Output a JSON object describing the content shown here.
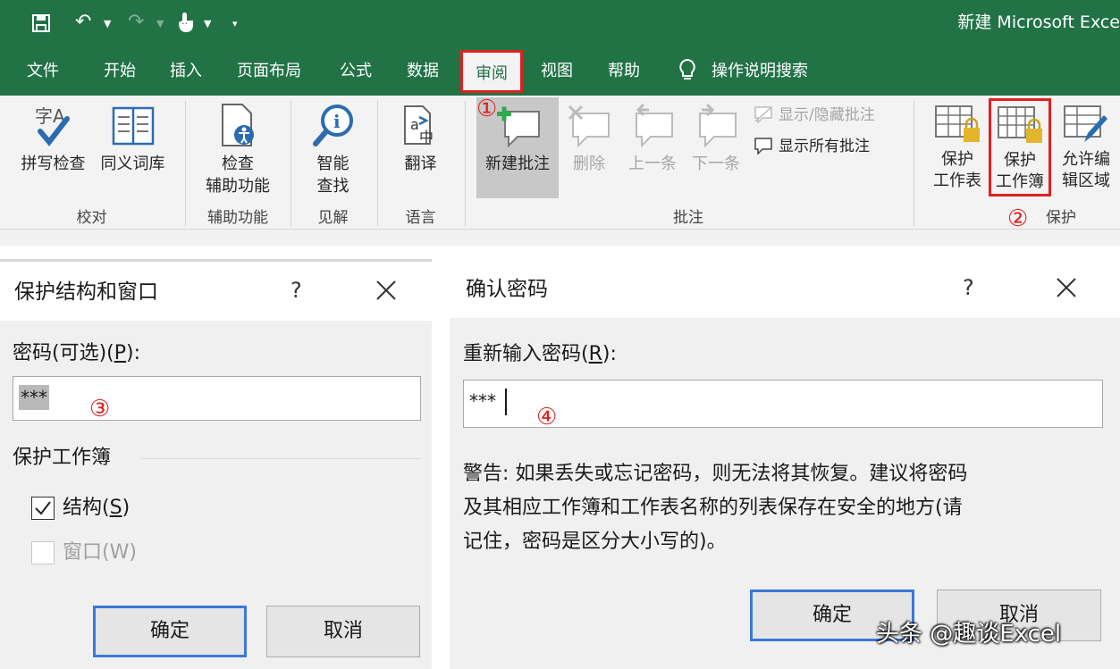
{
  "app": {
    "doc_title": "新建 Microsoft Exce"
  },
  "tabs": [
    {
      "label": "文件"
    },
    {
      "label": "开始"
    },
    {
      "label": "插入"
    },
    {
      "label": "页面布局"
    },
    {
      "label": "公式"
    },
    {
      "label": "数据"
    },
    {
      "label": "审阅"
    },
    {
      "label": "视图"
    },
    {
      "label": "帮助"
    },
    {
      "label": "操作说明搜索"
    }
  ],
  "ribbon": {
    "proofing": {
      "spell": "拼写检查",
      "thesaurus": "同义词库",
      "group": "校对"
    },
    "accessibility": {
      "line1": "检查",
      "line2": "辅助功能",
      "group": "辅助功能"
    },
    "insights": {
      "line1": "智能",
      "line2": "查找",
      "group": "见解"
    },
    "language": {
      "translate": "翻译",
      "group": "语言"
    },
    "comments": {
      "new": "新建批注",
      "delete": "删除",
      "prev": "上一条",
      "next": "下一条",
      "show_hide": "显示/隐藏批注",
      "show_all": "显示所有批注",
      "group": "批注"
    },
    "protect": {
      "sheet_l1": "保护",
      "sheet_l2": "工作表",
      "book_l1": "保护",
      "book_l2": "工作簿",
      "edit_l1": "允许编",
      "edit_l2": "辑区域",
      "group": "保护"
    }
  },
  "markers": {
    "m1": "①",
    "m2": "②",
    "m3": "③",
    "m4": "④"
  },
  "dialog_protect": {
    "title": "保护结构和窗口",
    "help": "?",
    "pwd_label_pre": "密码(可选)(",
    "pwd_label_key": "P",
    "pwd_label_post": "):",
    "pwd_value": "***",
    "section": "保护工作簿",
    "structure_pre": "结构(",
    "structure_key": "S",
    "structure_post": ")",
    "structure_checked": true,
    "window_label": "窗口(W)",
    "window_checked": false,
    "ok": "确定",
    "cancel": "取消"
  },
  "dialog_confirm": {
    "title": "确认密码",
    "help": "?",
    "label_pre": "重新输入密码(",
    "label_key": "R",
    "label_post": "):",
    "pwd_value": "***",
    "warn_l1": "警告: 如果丢失或忘记密码，则无法将其恢复。建议将密码",
    "warn_l2": "及其相应工作簿和工作表名称的列表保存在安全的地方(请",
    "warn_l3": "记住，密码是区分大小写的)。",
    "ok": "确定",
    "cancel": "取消"
  },
  "watermark": "头条 @趣谈Excel",
  "colors": {
    "excel_green": "#217346",
    "highlight_red": "#e02020",
    "default_button_blue": "#3b78d8"
  }
}
